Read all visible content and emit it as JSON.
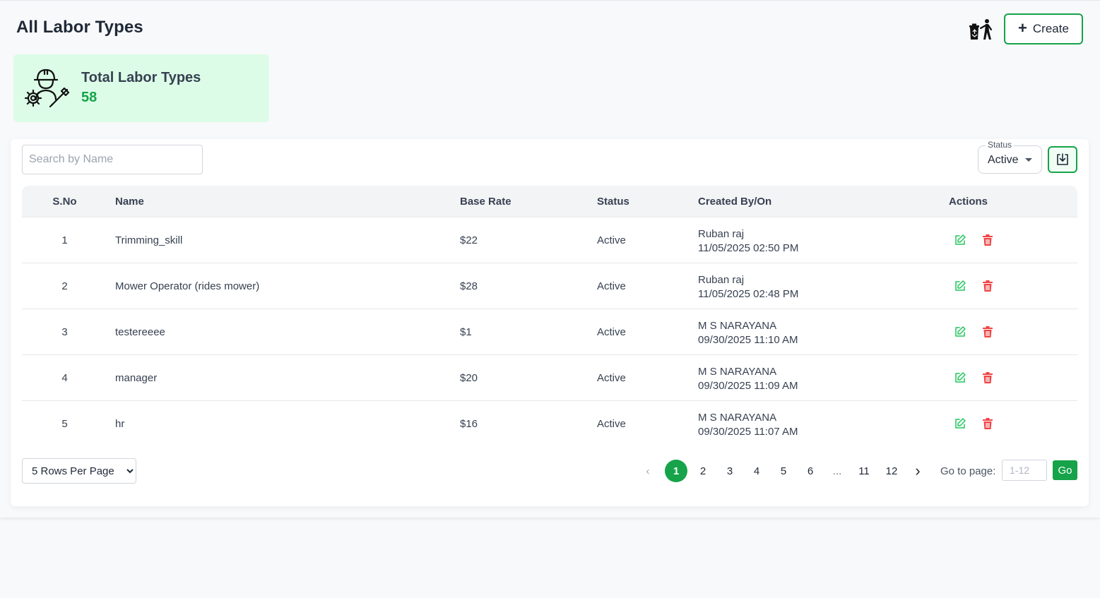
{
  "header": {
    "title": "All Labor Types",
    "create_label": "Create",
    "recycle_icon": "recycle-bin-icon"
  },
  "summary": {
    "label": "Total Labor Types",
    "value": "58",
    "icon": "worker-gear-icon"
  },
  "filters": {
    "search_placeholder": "Search by Name",
    "status_legend": "Status",
    "status_value": "Active"
  },
  "table": {
    "headers": {
      "sno": "S.No",
      "name": "Name",
      "rate": "Base Rate",
      "status": "Status",
      "created": "Created By/On",
      "actions": "Actions"
    },
    "rows": [
      {
        "sno": "1",
        "name": "Trimming_skill",
        "rate": "$22",
        "status": "Active",
        "created_by": "Ruban raj",
        "created_on": "11/05/2025 02:50 PM"
      },
      {
        "sno": "2",
        "name": "Mower Operator (rides mower)",
        "rate": "$28",
        "status": "Active",
        "created_by": "Ruban raj",
        "created_on": "11/05/2025 02:48 PM"
      },
      {
        "sno": "3",
        "name": "testereeee",
        "rate": "$1",
        "status": "Active",
        "created_by": "M S NARAYANA",
        "created_on": "09/30/2025 11:10 AM"
      },
      {
        "sno": "4",
        "name": "manager",
        "rate": "$20",
        "status": "Active",
        "created_by": "M S NARAYANA",
        "created_on": "09/30/2025 11:09 AM"
      },
      {
        "sno": "5",
        "name": "hr",
        "rate": "$16",
        "status": "Active",
        "created_by": "M S NARAYANA",
        "created_on": "09/30/2025 11:07 AM"
      }
    ]
  },
  "pagination": {
    "rows_per_page": "5 Rows Per Page",
    "pages": [
      "1",
      "2",
      "3",
      "4",
      "5",
      "6",
      "...",
      "11",
      "12"
    ],
    "current_page": "1",
    "goto_label": "Go to page:",
    "goto_placeholder": "1-12",
    "go_label": "Go"
  },
  "colors": {
    "accent": "#16a34a",
    "card_bg": "#dcfce7",
    "delete": "#ef4444",
    "edit": "#22c55e"
  }
}
